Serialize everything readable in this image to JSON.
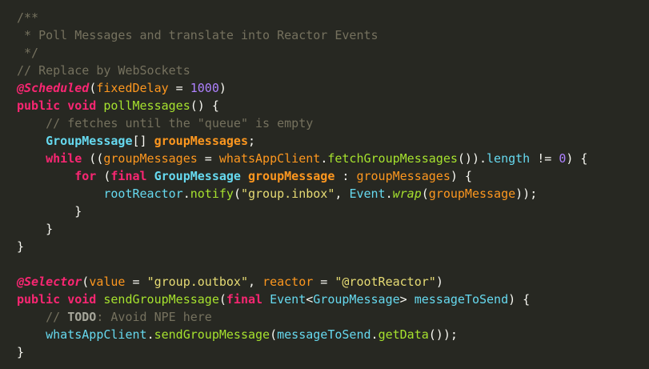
{
  "editor": {
    "lines": [
      [
        {
          "t": "/**",
          "c": "comment"
        }
      ],
      [
        {
          "t": " * Poll Messages and translate into Reactor Events",
          "c": "comment"
        }
      ],
      [
        {
          "t": " */",
          "c": "comment"
        }
      ],
      [
        {
          "t": "// Replace by WebSockets",
          "c": "comment"
        }
      ],
      [
        {
          "t": "@Scheduled",
          "c": "annotation"
        },
        {
          "t": "(",
          "c": "plain"
        },
        {
          "t": "fixedDelay",
          "c": "param"
        },
        {
          "t": " = ",
          "c": "plain"
        },
        {
          "t": "1000",
          "c": "number"
        },
        {
          "t": ")",
          "c": "plain"
        }
      ],
      [
        {
          "t": "public void ",
          "c": "keyword"
        },
        {
          "t": "pollMessages",
          "c": "method"
        },
        {
          "t": "() {",
          "c": "plain"
        }
      ],
      [
        {
          "t": "    ",
          "c": "plain"
        },
        {
          "t": "// fetches until the \"queue\" is empty",
          "c": "comment"
        }
      ],
      [
        {
          "t": "    ",
          "c": "plain"
        },
        {
          "t": "GroupMessage",
          "c": "type"
        },
        {
          "t": "[] ",
          "c": "plain"
        },
        {
          "t": "groupMessages",
          "c": "var"
        },
        {
          "t": ";",
          "c": "plain"
        }
      ],
      [
        {
          "t": "    ",
          "c": "plain"
        },
        {
          "t": "while",
          "c": "keyword"
        },
        {
          "t": " ((",
          "c": "plain"
        },
        {
          "t": "groupMessages",
          "c": "param"
        },
        {
          "t": " = ",
          "c": "plain"
        },
        {
          "t": "whatsAppClient",
          "c": "param"
        },
        {
          "t": ".",
          "c": "plain"
        },
        {
          "t": "fetchGroupMessages",
          "c": "method"
        },
        {
          "t": "()).",
          "c": "plain"
        },
        {
          "t": "length",
          "c": "field"
        },
        {
          "t": " != ",
          "c": "plain"
        },
        {
          "t": "0",
          "c": "number"
        },
        {
          "t": ") {",
          "c": "plain"
        }
      ],
      [
        {
          "t": "        ",
          "c": "plain"
        },
        {
          "t": "for",
          "c": "keyword"
        },
        {
          "t": " (",
          "c": "plain"
        },
        {
          "t": "final ",
          "c": "keyword"
        },
        {
          "t": "GroupMessage",
          "c": "type"
        },
        {
          "t": " ",
          "c": "plain"
        },
        {
          "t": "groupMessage",
          "c": "var"
        },
        {
          "t": " : ",
          "c": "plain"
        },
        {
          "t": "groupMessages",
          "c": "param"
        },
        {
          "t": ") {",
          "c": "plain"
        }
      ],
      [
        {
          "t": "            ",
          "c": "plain"
        },
        {
          "t": "rootReactor",
          "c": "field"
        },
        {
          "t": ".",
          "c": "plain"
        },
        {
          "t": "notify",
          "c": "method"
        },
        {
          "t": "(",
          "c": "plain"
        },
        {
          "t": "\"group.inbox\"",
          "c": "string"
        },
        {
          "t": ", ",
          "c": "plain"
        },
        {
          "t": "Event",
          "c": "field"
        },
        {
          "t": ".",
          "c": "plain"
        },
        {
          "t": "wrap",
          "c": "method-italic"
        },
        {
          "t": "(",
          "c": "plain"
        },
        {
          "t": "groupMessage",
          "c": "param"
        },
        {
          "t": "));",
          "c": "plain"
        }
      ],
      [
        {
          "t": "        }",
          "c": "plain"
        }
      ],
      [
        {
          "t": "    }",
          "c": "plain"
        }
      ],
      [
        {
          "t": "}",
          "c": "plain"
        }
      ],
      [
        {
          "t": "",
          "c": "plain"
        }
      ],
      [
        {
          "t": "@Selector",
          "c": "annotation"
        },
        {
          "t": "(",
          "c": "plain"
        },
        {
          "t": "value",
          "c": "param"
        },
        {
          "t": " = ",
          "c": "plain"
        },
        {
          "t": "\"group.outbox\"",
          "c": "string"
        },
        {
          "t": ", ",
          "c": "plain"
        },
        {
          "t": "reactor",
          "c": "param"
        },
        {
          "t": " = ",
          "c": "plain"
        },
        {
          "t": "\"@rootReactor\"",
          "c": "string"
        },
        {
          "t": ")",
          "c": "plain"
        }
      ],
      [
        {
          "t": "public void ",
          "c": "keyword"
        },
        {
          "t": "sendGroupMessage",
          "c": "method"
        },
        {
          "t": "(",
          "c": "plain"
        },
        {
          "t": "final ",
          "c": "keyword"
        },
        {
          "t": "Event",
          "c": "field"
        },
        {
          "t": "<",
          "c": "plain"
        },
        {
          "t": "GroupMessage",
          "c": "field"
        },
        {
          "t": "> ",
          "c": "plain"
        },
        {
          "t": "messageToSend",
          "c": "field"
        },
        {
          "t": ") {",
          "c": "plain"
        }
      ],
      [
        {
          "t": "    ",
          "c": "plain"
        },
        {
          "t": "// ",
          "c": "comment"
        },
        {
          "t": "TODO",
          "c": "todo"
        },
        {
          "t": ": Avoid NPE here",
          "c": "comment"
        }
      ],
      [
        {
          "t": "    ",
          "c": "plain"
        },
        {
          "t": "whatsAppClient",
          "c": "field"
        },
        {
          "t": ".",
          "c": "plain"
        },
        {
          "t": "sendGroupMessage",
          "c": "method"
        },
        {
          "t": "(",
          "c": "plain"
        },
        {
          "t": "messageToSend",
          "c": "field"
        },
        {
          "t": ".",
          "c": "plain"
        },
        {
          "t": "getData",
          "c": "method"
        },
        {
          "t": "());",
          "c": "plain"
        }
      ],
      [
        {
          "t": "}",
          "c": "plain"
        }
      ]
    ]
  }
}
